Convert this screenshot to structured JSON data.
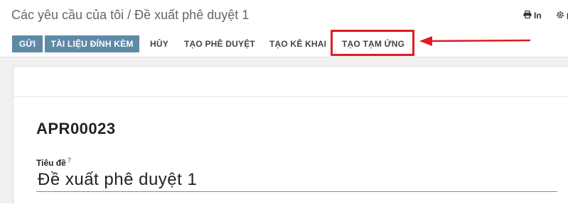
{
  "breadcrumb": {
    "parent": "Các yêu cầu của tôi",
    "separator": "/",
    "current": "Đề xuất phê duyệt 1"
  },
  "top_actions": {
    "print_label": "In",
    "gear_label": "I"
  },
  "statusbar": {
    "send_label": "GỬI",
    "attachments_label": "TÀI LIỆU ĐÍNH KÈM",
    "cancel_label": "HỦY",
    "create_approval_label": "TẠO PHÊ DUYỆT",
    "create_declaration_label": "TẠO KÊ KHAI",
    "create_advance_label": "TẠO TẠM ỨNG"
  },
  "form": {
    "record_name": "APR00023",
    "title_label": "Tiêu đề",
    "title_help": "?",
    "title_value": "Đề xuất phê duyệt 1"
  },
  "annotation": {
    "highlight_color": "#e01b22"
  }
}
